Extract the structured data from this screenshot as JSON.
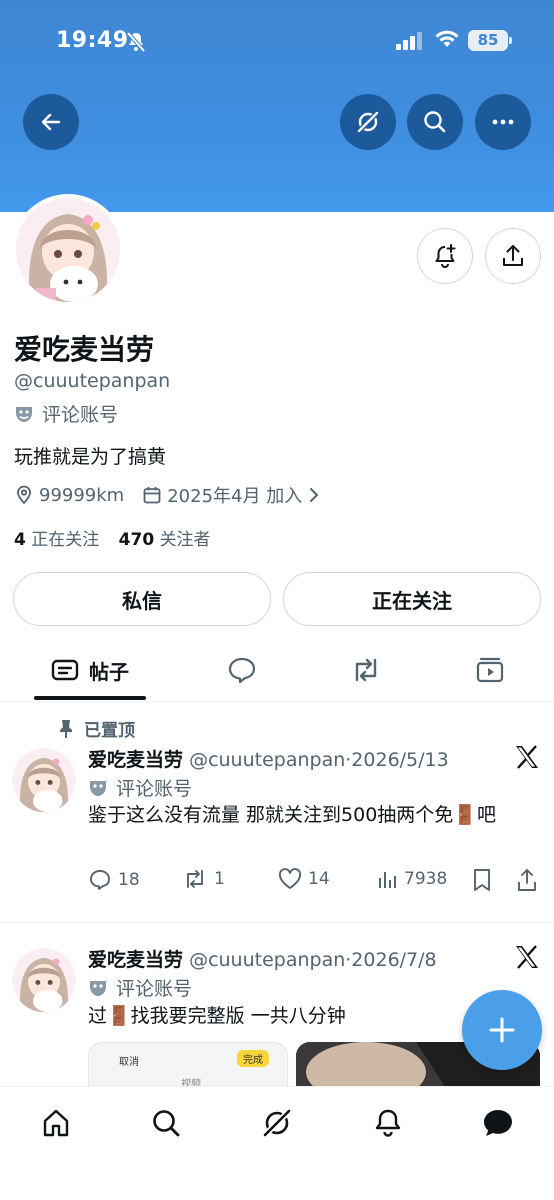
{
  "status_bar": {
    "time": "19:49",
    "battery": "85"
  },
  "profile": {
    "name": "爱吃麦当劳",
    "handle": "@cuuutepanpan",
    "account_label": "评论账号",
    "bio": "玩推就是为了搞黄",
    "location": "99999km",
    "joined": "2025年4月 加入",
    "following_count": "4",
    "following_label": "正在关注",
    "followers_count": "470",
    "followers_label": "关注者"
  },
  "buttons": {
    "message": "私信",
    "following": "正在关注"
  },
  "tabs": [
    {
      "label": "帖子",
      "icon": "posts-icon",
      "active": true
    },
    {
      "label": "",
      "icon": "reply-icon"
    },
    {
      "label": "",
      "icon": "repost-icon"
    },
    {
      "label": "",
      "icon": "media-icon"
    }
  ],
  "posts": [
    {
      "pinned_label": "已置顶",
      "name": "爱吃麦当劳",
      "meta": "@cuuutepanpan·2026/5/13",
      "account_label": "评论账号",
      "text": "鉴于这么没有流量 那就关注到500抽两个免🚪吧",
      "replies": "18",
      "reposts": "1",
      "likes": "14",
      "views": "7938"
    },
    {
      "name": "爱吃麦当劳",
      "meta": "@cuuutepanpan·2026/7/8",
      "account_label": "评论账号",
      "text": "过🚪找我要完整版 一共八分钟",
      "media": {
        "cancel": "取消",
        "done": "完成",
        "title": "视频"
      }
    }
  ],
  "colors": {
    "banner": "#3f8ee0",
    "header_button": "#1d5a9c",
    "fab": "#4a9fe8",
    "secondary_text": "#536471"
  }
}
